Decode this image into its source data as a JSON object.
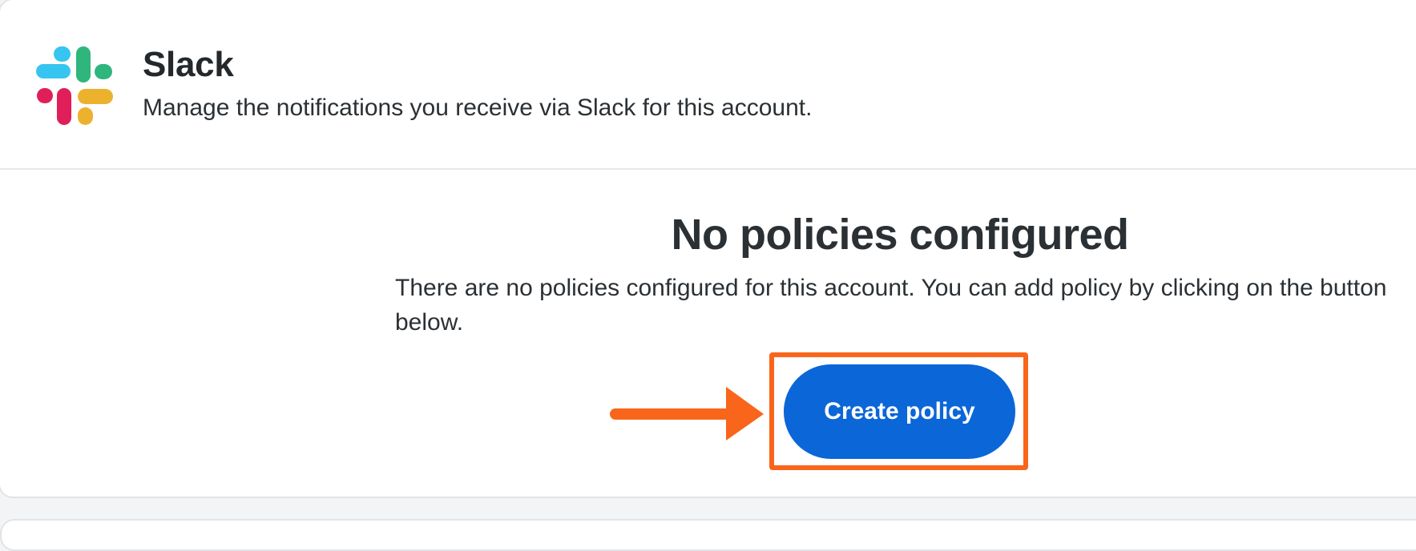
{
  "integration": {
    "name": "Slack",
    "description": "Manage the notifications you receive via Slack for this account.",
    "logo_icon": "slack-logo-icon"
  },
  "empty_state": {
    "title": "No policies configured",
    "description": "There are no policies configured for this account. You can add policy by clicking on the button below.",
    "button_label": "Create policy"
  },
  "annotation": {
    "arrow_icon": "arrow-right-icon",
    "highlight_color": "#f9651a"
  },
  "colors": {
    "button": "#0b66d8",
    "slack_blue": "#36c5f0",
    "slack_green": "#2eb67d",
    "slack_red": "#e01e5a",
    "slack_yellow": "#ecb22e"
  }
}
